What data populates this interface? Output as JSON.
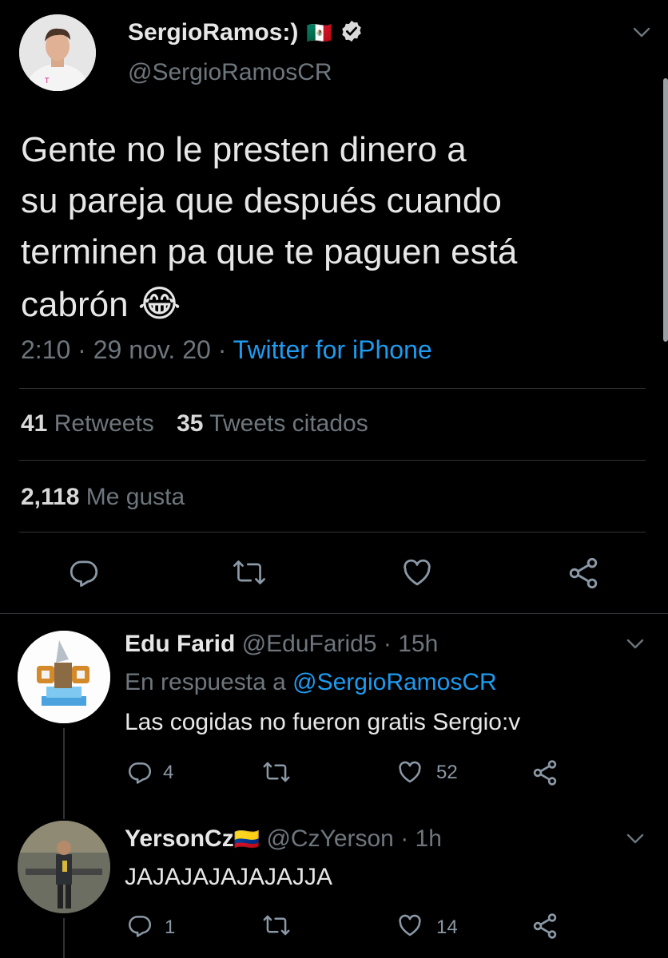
{
  "main_tweet": {
    "display_name": "SergioRamos:)",
    "flag_emoji": "🇲🇽",
    "handle": "@SergioRamosCR",
    "text_lines": [
      "Gente no le presten dinero a",
      "su pareja que después cuando",
      "terminen pa que te paguen está",
      "cabrón"
    ],
    "emoji": "😂",
    "time": "2:10",
    "date": "29 nov. 20",
    "source": "Twitter for iPhone",
    "retweets": "41",
    "retweets_label": "Retweets",
    "quotes": "35",
    "quotes_label": "Tweets citados",
    "likes": "2,118",
    "likes_label": "Me gusta"
  },
  "replies": [
    {
      "display_name": "Edu Farid",
      "handle": "@EduFarid5",
      "time": "15h",
      "reply_to_label": "En respuesta a",
      "reply_to_handle": "@SergioRamosCR",
      "text": "Las cogidas no fueron gratis Sergio:v",
      "reply_count": "4",
      "like_count": "52"
    },
    {
      "display_name": "YersonCz",
      "flag_emoji": "🇨🇴",
      "handle": "@CzYerson",
      "time": "1h",
      "text": "JAJAJAJAJAJAJJA",
      "reply_count": "1",
      "like_count": "14"
    }
  ],
  "separator": "·",
  "colors": {
    "background": "#000000",
    "text": "#d9d9d9",
    "muted": "#6e767d",
    "link": "#1d9bf0",
    "verified_badge": "#d9d9d9",
    "divider": "#2f3336"
  },
  "icons": [
    "verified-badge-icon",
    "chevron-down-icon",
    "reply-icon",
    "retweet-icon",
    "like-icon",
    "share-icon"
  ]
}
